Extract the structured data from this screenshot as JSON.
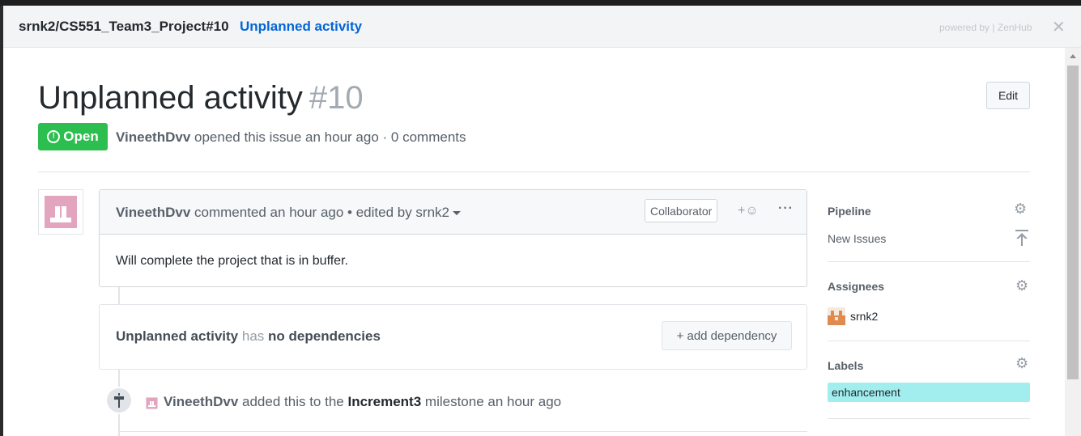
{
  "header": {
    "repo_path": "srnk2/CS551_Team3_Project#10",
    "issue_link": "Unplanned activity",
    "powered_by": "powered by | ZenHub",
    "close_symbol": "✕"
  },
  "issue": {
    "title": "Unplanned activity",
    "number": "#10",
    "state": "Open",
    "author": "VineethDvv",
    "meta_text": "opened this issue an hour ago · 0 comments",
    "edit_label": "Edit"
  },
  "comment": {
    "author": "VineethDvv",
    "action": "commented an hour ago • edited by srnk2",
    "role_badge": "Collaborator",
    "reaction_label": "+☺",
    "more_label": "···",
    "body": "Will complete the project that is in buffer."
  },
  "dependencies": {
    "issue_name": "Unplanned activity",
    "has_word": "has",
    "status": "no dependencies",
    "add_label": "+ add dependency"
  },
  "event": {
    "actor": "VineethDvv",
    "text_before": "added this to the",
    "milestone": "Increment3",
    "text_after": "milestone an hour ago"
  },
  "sidebar": {
    "pipeline": {
      "heading": "Pipeline",
      "value": "New Issues"
    },
    "assignees": {
      "heading": "Assignees",
      "value": "srnk2"
    },
    "labels": {
      "heading": "Labels",
      "items": [
        {
          "name": "enhancement",
          "color": "#a2eeef"
        }
      ]
    }
  },
  "colors": {
    "open_green": "#2cbe4e",
    "link_blue": "#0366d6",
    "identicon_pink": "#e3a5bd",
    "assignee_orange": "#e08a4f"
  }
}
